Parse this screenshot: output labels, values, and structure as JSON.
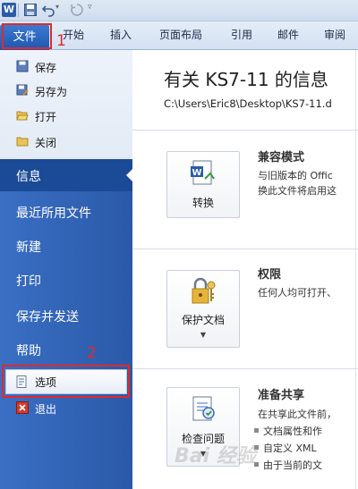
{
  "toolbar": {
    "logo_letter": "W"
  },
  "tabs": {
    "file": "文件",
    "items": [
      "开始",
      "插入",
      "页面布局",
      "引用",
      "邮件",
      "审阅"
    ]
  },
  "annotations": {
    "num1": "1",
    "num2": "2",
    "color": "#e02a2a"
  },
  "nav": {
    "commands": [
      {
        "label": "保存",
        "icon": "save-icon"
      },
      {
        "label": "另存为",
        "icon": "save-as-icon"
      },
      {
        "label": "打开",
        "icon": "open-folder-icon"
      },
      {
        "label": "关闭",
        "icon": "close-folder-icon"
      }
    ],
    "info": "信息",
    "recent": "最近所用文件",
    "new": "新建",
    "print": "打印",
    "save_send": "保存并发送",
    "help": "帮助",
    "options": "选项",
    "exit": "退出"
  },
  "main": {
    "title": "有关 KS7-11 的信息",
    "path": "C:\\Users\\Eric8\\Desktop\\KS7-11.d",
    "convert": {
      "button": "转换",
      "heading": "兼容模式",
      "line1": "与旧版本的 Offic",
      "line2": "换此文件将启用这"
    },
    "permissions": {
      "button": "保护文档",
      "heading": "权限",
      "line1": "任何人均可打开、"
    },
    "prepare": {
      "button": "检查问题",
      "heading": "准备共享",
      "line1": "在共享此文件前，",
      "bullets": [
        "文档属性和作",
        "自定义 XML",
        "由于当前的文"
      ]
    }
  },
  "watermark": "Bai 经验",
  "colors": {
    "accent_blue": "#2b59a8",
    "file_tab": "#1e56b0"
  }
}
